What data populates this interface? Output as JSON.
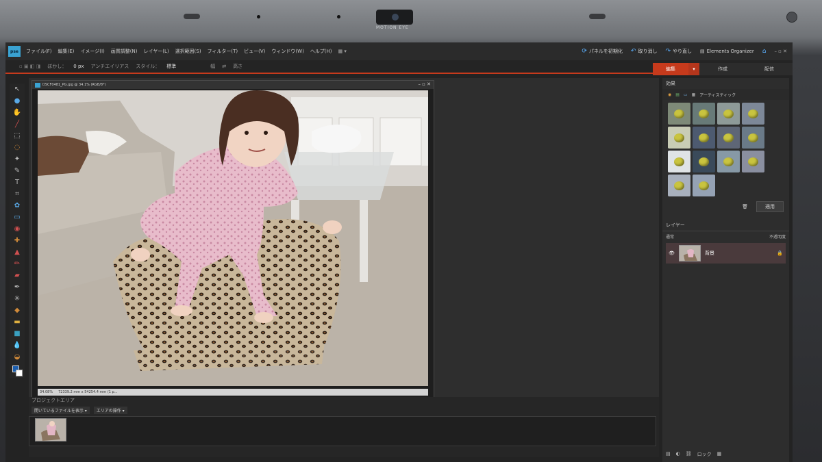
{
  "camera": {
    "label": "MOTION EYE"
  },
  "app": {
    "logo": "pse"
  },
  "menubar": {
    "items": [
      "ファイル(F)",
      "編集(E)",
      "イメージ(I)",
      "画質調整(N)",
      "レイヤー(L)",
      "選択範囲(S)",
      "フィルター(T)",
      "ビュー(V)",
      "ウィンドウ(W)",
      "ヘルプ(H)"
    ],
    "reset_panels": "パネルを初期化",
    "undo": "取り消し",
    "redo": "やり直し",
    "organizer": "Elements Organizer"
  },
  "optionsbar": {
    "feather": "ぼかし：",
    "feather_value": "0 px",
    "antialias": "アンチエイリアス",
    "style_label": "スタイル：",
    "style_value": "標準",
    "width": "幅",
    "height": "高さ"
  },
  "modes": {
    "edit": "編集",
    "create": "作成",
    "share": "配信"
  },
  "document": {
    "title": "DSCF0481_PG.jpg @ 34.1% (RGB/8*)",
    "zoom": "34.08%",
    "size": "72339.2 mm x 54254.4 mm (1 p..."
  },
  "project_bin": {
    "title": "プロジェクトエリア",
    "show_label": "開いているファイルを表示",
    "ops_label": "エリアの操作"
  },
  "effects": {
    "title": "効果",
    "category": "アーティスティック",
    "apply": "適用",
    "tile_colors": [
      "#7e8a78",
      "#687a78",
      "#8e9a98",
      "#7d8898",
      "#c8ccb5",
      "#4d5a70",
      "#5e6676",
      "#6a7a88",
      "#dfe3e6",
      "#3a4a5a",
      "#8799a6",
      "#8a8fa0",
      "#a8b0bd",
      "#95a2b4"
    ]
  },
  "layers": {
    "title": "レイヤー",
    "blend": "通常",
    "opacity": "不透明度",
    "items": [
      {
        "name": "背景"
      }
    ],
    "lock": "ロック"
  }
}
